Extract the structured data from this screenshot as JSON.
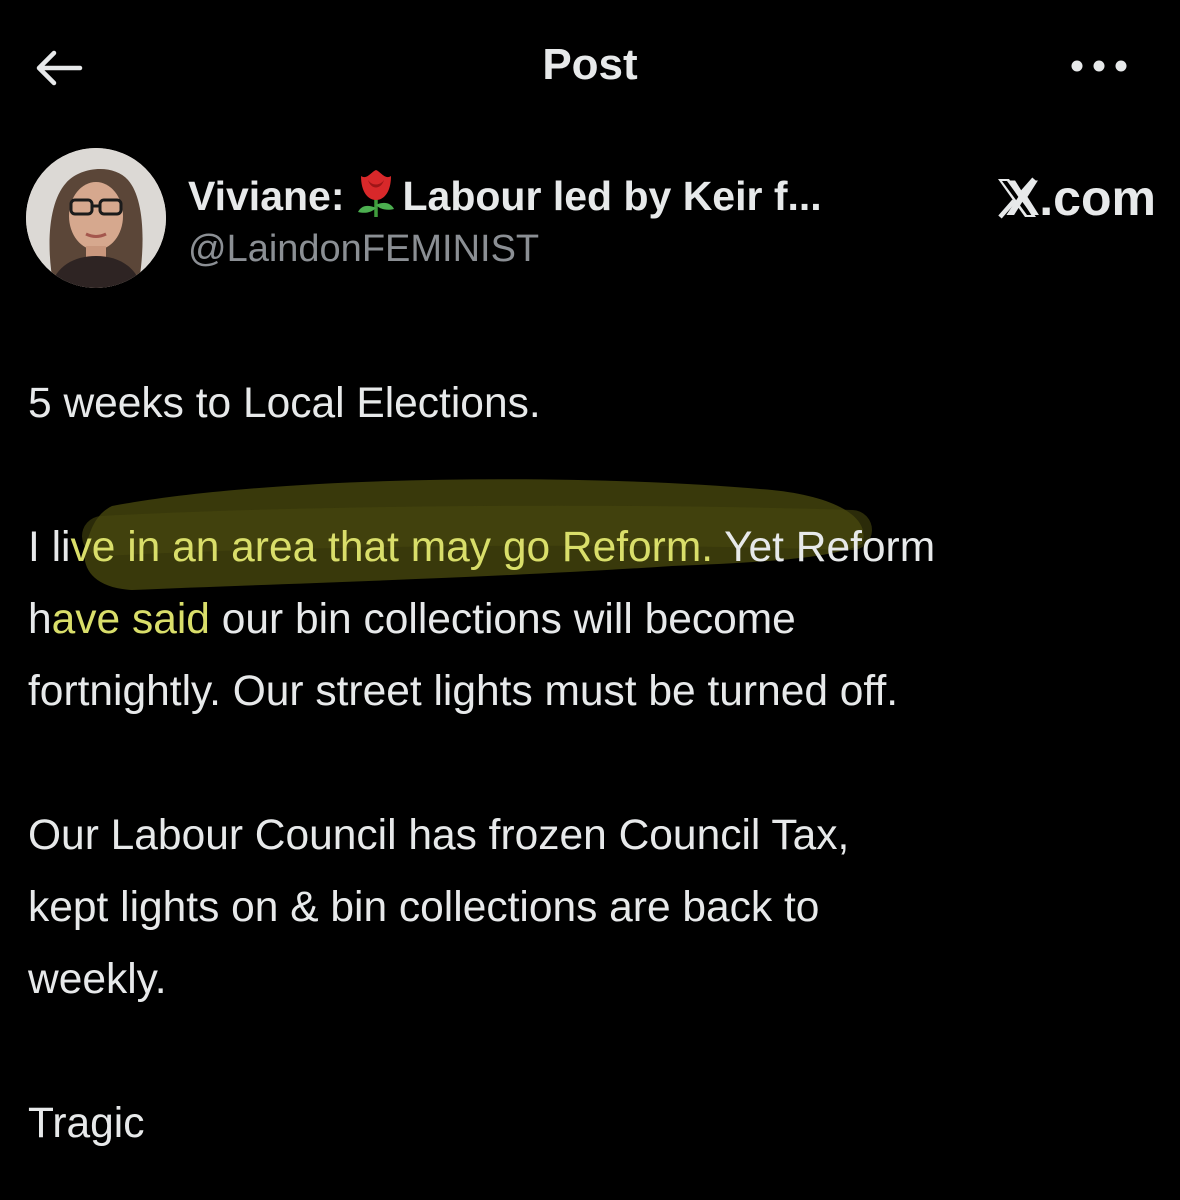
{
  "header": {
    "title": "Post",
    "back_icon": "arrow-left-icon",
    "more_icon": "more-horizontal-icon"
  },
  "author": {
    "display_name_before": "Viviane:",
    "display_name_emoji": "rose-emoji-icon",
    "display_name_after": "Labour led by Keir f...",
    "handle": "@LaindonFEMINIST",
    "watermark": "X.com"
  },
  "post": {
    "p1": "5 weeks to Local Elections.",
    "p2_lead": "I li",
    "p2_highlight": "ve in an area that may go Reform.",
    "p2_mid": " Yet Reform",
    "p2_line2_lead": "h",
    "p2_line2_highlight": "ave said",
    "p2_line2_rest": " our bin collections will become",
    "p2_line3": "fortnightly. Our street lights must be turned off.",
    "p3_line1": "Our Labour Council has frozen Council Tax,",
    "p3_line2": "kept lights on & bin collections are back to",
    "p3_line3": "weekly.",
    "p4": "Tragic"
  },
  "colors": {
    "background": "#000000",
    "text": "#e7e9ea",
    "secondary_text": "#8b8f94",
    "highlight_marker": "#5a5a12",
    "highlight_text": "#d9de6a"
  }
}
